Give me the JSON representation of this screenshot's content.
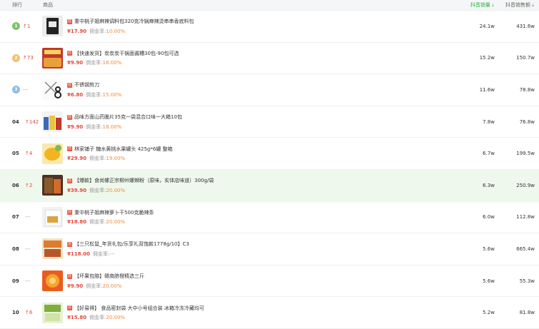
{
  "header": {
    "rank_label": "排行",
    "product_label": "商品",
    "sales_label": "抖音销量",
    "gmv_label": "抖音销售额"
  },
  "shop_tag": "店",
  "commission_label": "佣金率:",
  "rows": [
    {
      "rank": "1",
      "delta": "↑1",
      "title": "重中桃子姐麻辣调料包320克冷锅麻辣烫串串香底料包",
      "price": "¥17.90",
      "commission": "10.00%",
      "sales": "24.1w",
      "gmv": "431.6w"
    },
    {
      "rank": "2",
      "delta": "↑73",
      "title": "【快速发货】炭炭炭干锅面酱糟30包-90包可选",
      "price": "¥9.90",
      "commission": "16.00%",
      "sales": "15.2w",
      "gmv": "150.7w"
    },
    {
      "rank": "3",
      "delta": "---",
      "title": "不锈钢剪刀",
      "price": "¥6.80",
      "commission": "15.00%",
      "sales": "11.6w",
      "gmv": "78.8w"
    },
    {
      "rank": "04",
      "delta": "↑142",
      "title": "品味方面山药脆片35克一袋混合口味一大箱10包",
      "price": "¥9.90",
      "commission": "18.00%",
      "sales": "7.8w",
      "gmv": "76.8w"
    },
    {
      "rank": "05",
      "delta": "↑4",
      "title": "林家铺子 糖水黄桃水果罐头 425g*6罐 整箱",
      "price": "¥29.90",
      "commission": "19.00%",
      "sales": "6.7w",
      "gmv": "199.5w"
    },
    {
      "rank": "06",
      "delta": "↑2",
      "title": "【爆款】食尚螺正宗柳州螺蛳粉（原味，实体店味道）300g/袋",
      "price": "¥39.90",
      "commission": "20.00%",
      "sales": "6.3w",
      "gmv": "250.9w"
    },
    {
      "rank": "07",
      "delta": "---",
      "title": "重中桃子姐麻辣萝卜干500克脆辣条",
      "price": "¥18.80",
      "commission": "20.00%",
      "sales": "6.0w",
      "gmv": "112.8w"
    },
    {
      "rank": "08",
      "delta": "---",
      "title": "【三只松鼠_年货礼包/乐享礼双饱款1778g/10】C3",
      "price": "¥118.00",
      "commission": "---",
      "sales": "5.6w",
      "gmv": "665.4w"
    },
    {
      "rank": "09",
      "delta": "---",
      "title": "【坏果包赔】赣南脐橙精选三斤",
      "price": "¥9.90",
      "commission": "20.00%",
      "sales": "5.6w",
      "gmv": "55.3w"
    },
    {
      "rank": "10",
      "delta": "↑6",
      "title": "【好易得】 食品密封袋 大中小号组合装 冰箱冷冻冷藏均可",
      "price": "¥15.80",
      "commission": "20.00%",
      "sales": "5.2w",
      "gmv": "81.8w"
    }
  ]
}
